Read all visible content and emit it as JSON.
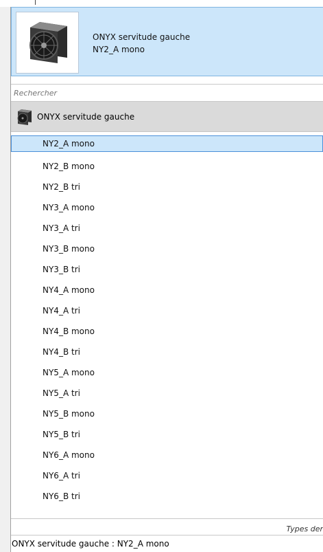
{
  "header": {
    "title": "ONYX servitude gauche",
    "subtitle": "NY2_A mono",
    "thumbnail_icon": "fan-unit-icon"
  },
  "search": {
    "placeholder": "Rechercher"
  },
  "family": {
    "label": "ONYX servitude gauche",
    "icon": "fan-unit-icon"
  },
  "types": [
    {
      "label": "NY2_A mono",
      "selected": true
    },
    {
      "label": "NY2_B mono"
    },
    {
      "label": "NY2_B tri"
    },
    {
      "label": "NY3_A mono"
    },
    {
      "label": "NY3_A tri"
    },
    {
      "label": "NY3_B mono"
    },
    {
      "label": "NY3_B tri"
    },
    {
      "label": "NY4_A mono"
    },
    {
      "label": "NY4_A tri"
    },
    {
      "label": "NY4_B mono"
    },
    {
      "label": "NY4_B tri"
    },
    {
      "label": "NY5_A mono"
    },
    {
      "label": "NY5_A tri"
    },
    {
      "label": "NY5_B mono"
    },
    {
      "label": "NY5_B tri"
    },
    {
      "label": "NY6_A mono"
    },
    {
      "label": "NY6_A tri"
    },
    {
      "label": "NY6_B tri"
    }
  ],
  "footer": {
    "right_label": "Types der",
    "status": "ONYX servitude gauche : NY2_A mono"
  },
  "colors": {
    "selection_bg": "#cce6fa",
    "selection_border": "#4a90d9",
    "family_bg": "#dadada"
  }
}
